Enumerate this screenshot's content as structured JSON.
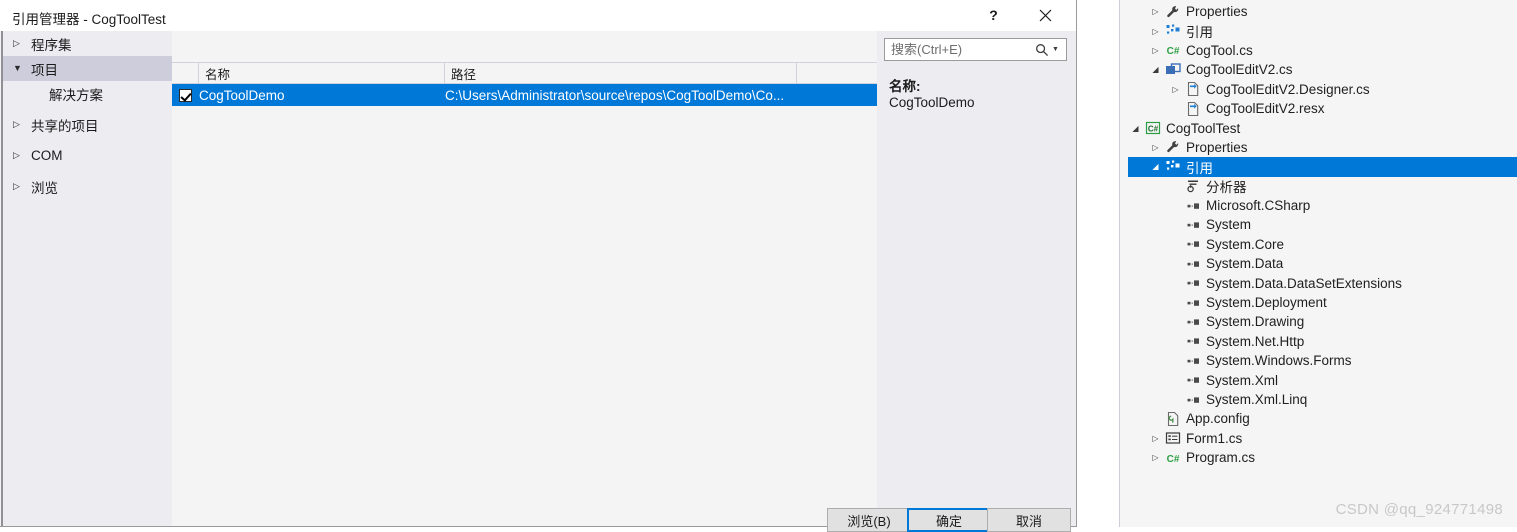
{
  "dialog": {
    "title": "引用管理器 - CogToolTest",
    "help_button": "?",
    "close_button": "close-icon",
    "categories": [
      {
        "label": "程序集",
        "twisty": "collapsed",
        "selected": false,
        "child": false
      },
      {
        "label": "项目",
        "twisty": "expanded",
        "selected": true,
        "child": false
      },
      {
        "label": "解决方案",
        "twisty": "none",
        "selected": false,
        "child": true
      },
      {
        "label": "共享的项目",
        "twisty": "collapsed",
        "selected": false,
        "child": false
      },
      {
        "label": "COM",
        "twisty": "collapsed",
        "selected": false,
        "child": false
      },
      {
        "label": "浏览",
        "twisty": "collapsed",
        "selected": false,
        "child": false
      }
    ],
    "columns": [
      "",
      "名称",
      "路径",
      ""
    ],
    "rows": [
      {
        "checked": true,
        "name": "CogToolDemo",
        "path": "C:\\Users\\Administrator\\source\\repos\\CogToolDemo\\Co...",
        "selected": true
      }
    ],
    "search": {
      "placeholder": "搜索(Ctrl+E)",
      "value": "",
      "icon": "search-icon",
      "dropdown_icon": "chevron-down-icon"
    },
    "detail": {
      "name_label": "名称:",
      "name_value": "CogToolDemo"
    },
    "buttons": {
      "browse": "浏览(B)",
      "ok": "确定",
      "cancel": "取消"
    }
  },
  "explorer": {
    "watermark": "CSDN @qq_924771498",
    "items": [
      {
        "label": "Properties",
        "indent": 2,
        "twisty": "collapsed",
        "icon": "wrench-icon",
        "selected": false
      },
      {
        "label": "引用",
        "indent": 2,
        "twisty": "collapsed",
        "icon": "references-icon",
        "selected": false
      },
      {
        "label": "CogTool.cs",
        "indent": 2,
        "twisty": "collapsed",
        "icon": "csharp-icon",
        "selected": false
      },
      {
        "label": "CogToolEditV2.cs",
        "indent": 2,
        "twisty": "expanded",
        "icon": "form-icon",
        "selected": false
      },
      {
        "label": "CogToolEditV2.Designer.cs",
        "indent": 3,
        "twisty": "collapsed",
        "icon": "designer-icon",
        "selected": false
      },
      {
        "label": "CogToolEditV2.resx",
        "indent": 3,
        "twisty": "none",
        "icon": "designer-icon",
        "selected": false
      },
      {
        "label": "CogToolTest",
        "indent": 1,
        "twisty": "expanded",
        "icon": "project-icon",
        "selected": false
      },
      {
        "label": "Properties",
        "indent": 2,
        "twisty": "collapsed",
        "icon": "wrench-icon",
        "selected": false
      },
      {
        "label": "引用",
        "indent": 2,
        "twisty": "expanded",
        "icon": "references-icon",
        "selected": true
      },
      {
        "label": "分析器",
        "indent": 3,
        "twisty": "none",
        "icon": "analyzer-icon",
        "selected": false
      },
      {
        "label": "Microsoft.CSharp",
        "indent": 3,
        "twisty": "none",
        "icon": "assembly-icon",
        "selected": false
      },
      {
        "label": "System",
        "indent": 3,
        "twisty": "none",
        "icon": "assembly-icon",
        "selected": false
      },
      {
        "label": "System.Core",
        "indent": 3,
        "twisty": "none",
        "icon": "assembly-icon",
        "selected": false
      },
      {
        "label": "System.Data",
        "indent": 3,
        "twisty": "none",
        "icon": "assembly-icon",
        "selected": false
      },
      {
        "label": "System.Data.DataSetExtensions",
        "indent": 3,
        "twisty": "none",
        "icon": "assembly-icon",
        "selected": false
      },
      {
        "label": "System.Deployment",
        "indent": 3,
        "twisty": "none",
        "icon": "assembly-icon",
        "selected": false
      },
      {
        "label": "System.Drawing",
        "indent": 3,
        "twisty": "none",
        "icon": "assembly-icon",
        "selected": false
      },
      {
        "label": "System.Net.Http",
        "indent": 3,
        "twisty": "none",
        "icon": "assembly-icon",
        "selected": false
      },
      {
        "label": "System.Windows.Forms",
        "indent": 3,
        "twisty": "none",
        "icon": "assembly-icon",
        "selected": false
      },
      {
        "label": "System.Xml",
        "indent": 3,
        "twisty": "none",
        "icon": "assembly-icon",
        "selected": false
      },
      {
        "label": "System.Xml.Linq",
        "indent": 3,
        "twisty": "none",
        "icon": "assembly-icon",
        "selected": false
      },
      {
        "label": "App.config",
        "indent": 2,
        "twisty": "none",
        "icon": "config-icon",
        "selected": false
      },
      {
        "label": "Form1.cs",
        "indent": 2,
        "twisty": "collapsed",
        "icon": "form-list-icon",
        "selected": false
      },
      {
        "label": "Program.cs",
        "indent": 2,
        "twisty": "collapsed",
        "icon": "csharp-icon",
        "selected": false
      }
    ]
  },
  "colors": {
    "accent": "#0078d7",
    "dialog_bg": "#f4f4f4",
    "pane_bg": "#edecf1",
    "selected_cat": "#cdcddc"
  }
}
